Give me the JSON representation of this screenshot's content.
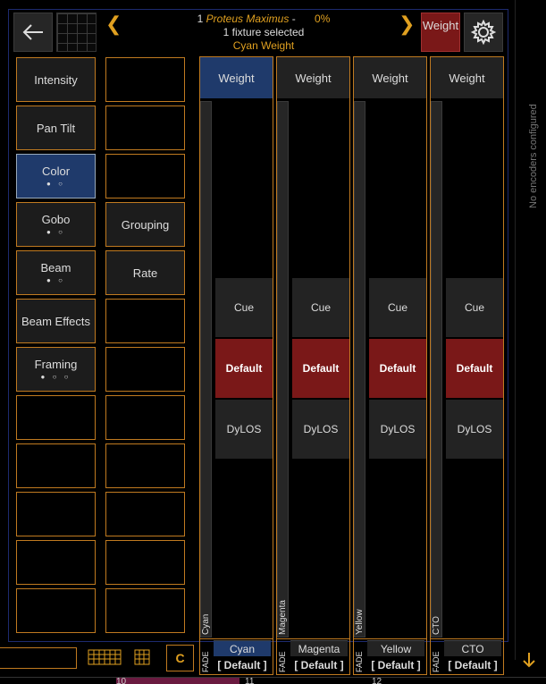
{
  "header": {
    "fixture_number": "1",
    "fixture_name": "Proteus Maximus",
    "separator": "-",
    "intensity_percent": "0%",
    "selection_text": "1 fixture selected",
    "attribute_name": "Cyan Weight",
    "weight_button_label": "Weight",
    "icons": {
      "back": "back-arrow-icon",
      "grid": "grid-thumbnail",
      "prev": "chevron-left-icon",
      "next": "chevron-right-icon",
      "settings": "gear-icon"
    }
  },
  "feature_groups": {
    "left": [
      {
        "label": "Intensity",
        "dots": ""
      },
      {
        "label": "Pan Tilt",
        "dots": ""
      },
      {
        "label": "Color",
        "dots": "● ○",
        "active": true
      },
      {
        "label": "Gobo",
        "dots": "● ○"
      },
      {
        "label": "Beam",
        "dots": "● ○"
      },
      {
        "label": "Beam Effects",
        "dots": ""
      },
      {
        "label": "Framing",
        "dots": "● ○ ○"
      },
      {
        "label": "",
        "dots": ""
      },
      {
        "label": "",
        "dots": ""
      },
      {
        "label": "",
        "dots": ""
      },
      {
        "label": "",
        "dots": ""
      },
      {
        "label": "",
        "dots": ""
      }
    ],
    "right": [
      {
        "label": ""
      },
      {
        "label": ""
      },
      {
        "label": ""
      },
      {
        "label": "Grouping"
      },
      {
        "label": "Rate"
      },
      {
        "label": ""
      },
      {
        "label": ""
      },
      {
        "label": ""
      },
      {
        "label": ""
      },
      {
        "label": ""
      },
      {
        "label": ""
      },
      {
        "label": ""
      }
    ]
  },
  "parameters": [
    {
      "header": "Weight",
      "fader_label": "Cyan",
      "name": "Cyan",
      "value": "[ Default ]",
      "fade_label": "FADE",
      "active": true,
      "buttons": [
        "Cue",
        "Default",
        "DyLOS"
      ]
    },
    {
      "header": "Weight",
      "fader_label": "Magenta",
      "name": "Magenta",
      "value": "[ Default ]",
      "fade_label": "FADE",
      "buttons": [
        "Cue",
        "Default",
        "DyLOS"
      ]
    },
    {
      "header": "Weight",
      "fader_label": "Yellow",
      "name": "Yellow",
      "value": "[ Default ]",
      "fade_label": "FADE",
      "buttons": [
        "Cue",
        "Default",
        "DyLOS"
      ]
    },
    {
      "header": "Weight",
      "fader_label": "CTO",
      "name": "CTO",
      "value": "[ Default ]",
      "fade_label": "FADE",
      "buttons": [
        "Cue",
        "Default",
        "DyLOS"
      ]
    }
  ],
  "encoders": {
    "empty_message": "No encoders configured",
    "scroll_icon": "down-arrow-icon"
  },
  "toolbar": {
    "command_line_value": "",
    "clear_button_label": "C",
    "icons": {
      "keyboard": "keyboard-icon",
      "numpad": "numpad-icon"
    }
  },
  "bottom_strip": [
    "10",
    "11",
    "12"
  ]
}
